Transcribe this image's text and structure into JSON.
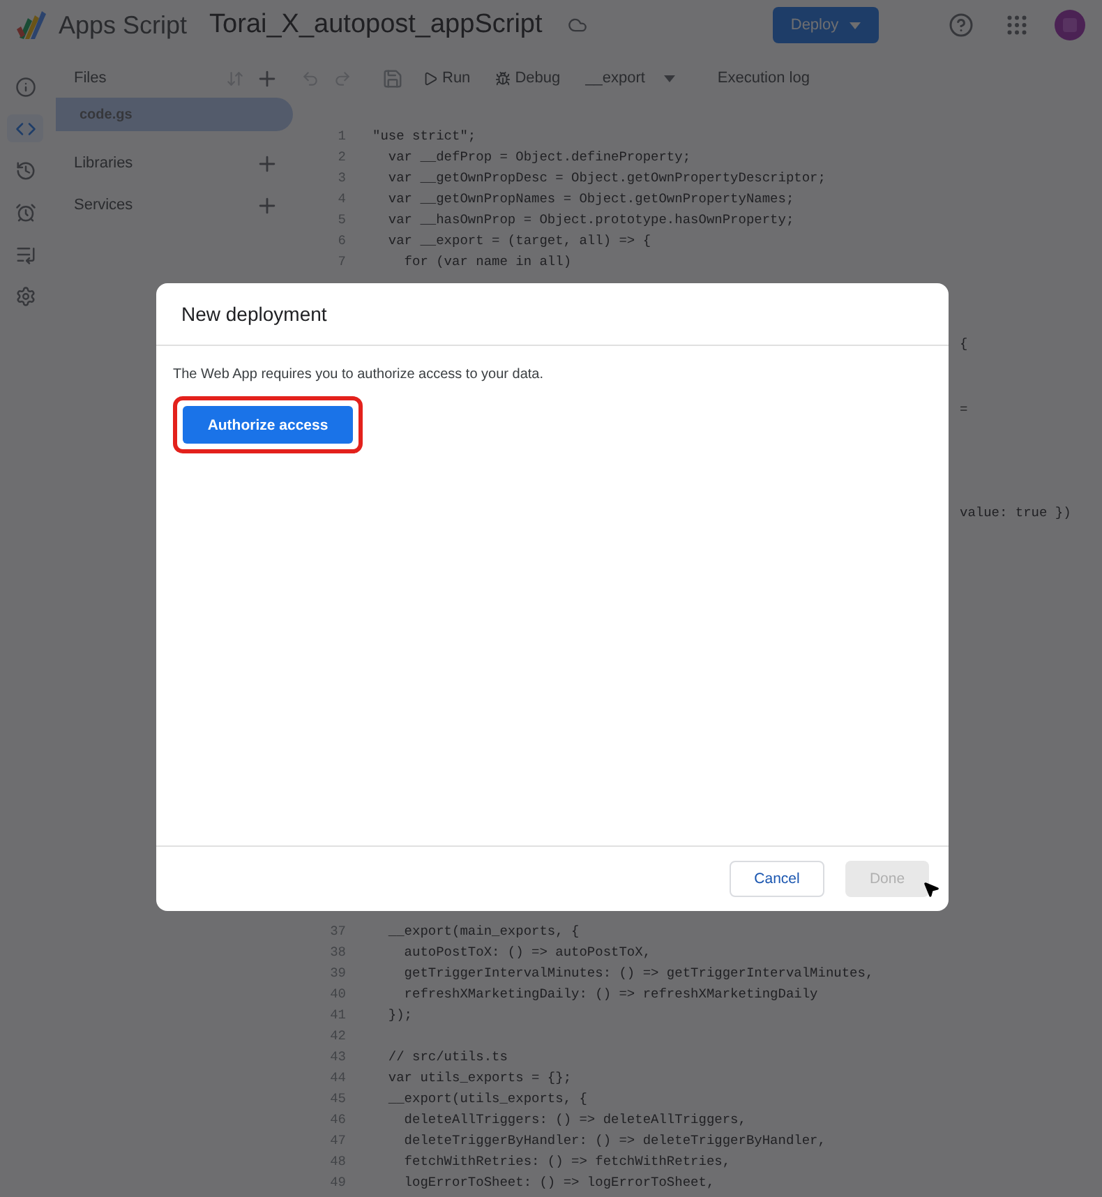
{
  "header": {
    "app_name": "Apps Script",
    "project_title": "Torai_X_autopost_appScript",
    "deploy_button": "Deploy"
  },
  "rail": [
    {
      "kind": "info",
      "selected": false
    },
    {
      "kind": "editor",
      "selected": true
    },
    {
      "kind": "history",
      "selected": false
    },
    {
      "kind": "triggers",
      "selected": false
    },
    {
      "kind": "executions",
      "selected": false
    },
    {
      "kind": "settings",
      "selected": false
    }
  ],
  "sidebar": {
    "files_label": "Files",
    "files": [
      {
        "name": "code.gs",
        "selected": true
      }
    ],
    "sections": [
      {
        "label": "Libraries"
      },
      {
        "label": "Services"
      }
    ]
  },
  "toolbar": {
    "run": "Run",
    "debug": "Debug",
    "function": "__export",
    "execution_log": "Execution log"
  },
  "code": {
    "top_lines": [
      {
        "number": "1",
        "text": "\"use strict\";"
      },
      {
        "number": "2",
        "text": "  var __defProp = Object.defineProperty;"
      },
      {
        "number": "3",
        "text": "  var __getOwnPropDesc = Object.getOwnPropertyDescriptor;"
      },
      {
        "number": "4",
        "text": "  var __getOwnPropNames = Object.getOwnPropertyNames;"
      },
      {
        "number": "5",
        "text": "  var __hasOwnProp = Object.prototype.hasOwnProperty;"
      },
      {
        "number": "6",
        "text": "  var __export = (target, all) => {"
      },
      {
        "number": "7",
        "text": "    for (var name in all)"
      }
    ],
    "fragments": [
      "{",
      "=",
      "value: true })"
    ],
    "bottom_lines": [
      {
        "number": "37",
        "text": "  __export(main_exports, {"
      },
      {
        "number": "38",
        "text": "    autoPostToX: () => autoPostToX,"
      },
      {
        "number": "39",
        "text": "    getTriggerIntervalMinutes: () => getTriggerIntervalMinutes,"
      },
      {
        "number": "40",
        "text": "    refreshXMarketingDaily: () => refreshXMarketingDaily"
      },
      {
        "number": "41",
        "text": "  });"
      },
      {
        "number": "42"
      },
      {
        "number": "43",
        "text": "  // src/utils.ts"
      },
      {
        "number": "44",
        "text": "  var utils_exports = {};"
      },
      {
        "number": "45",
        "text": "  __export(utils_exports, {"
      },
      {
        "number": "46",
        "text": "    deleteAllTriggers: () => deleteAllTriggers,"
      },
      {
        "number": "47",
        "text": "    deleteTriggerByHandler: () => deleteTriggerByHandler,"
      },
      {
        "number": "48",
        "text": "    fetchWithRetries: () => fetchWithRetries,"
      },
      {
        "number": "49",
        "text": "    logErrorToSheet: () => logErrorToSheet,"
      }
    ]
  },
  "dialog": {
    "title": "New deployment",
    "message": "The Web App requires you to authorize access to your data.",
    "authorize_button": "Authorize access",
    "buttons": [
      {
        "label": "Cancel",
        "kind": "secondary",
        "disabled": false
      },
      {
        "label": "Done",
        "kind": "primary",
        "disabled": true
      }
    ]
  }
}
